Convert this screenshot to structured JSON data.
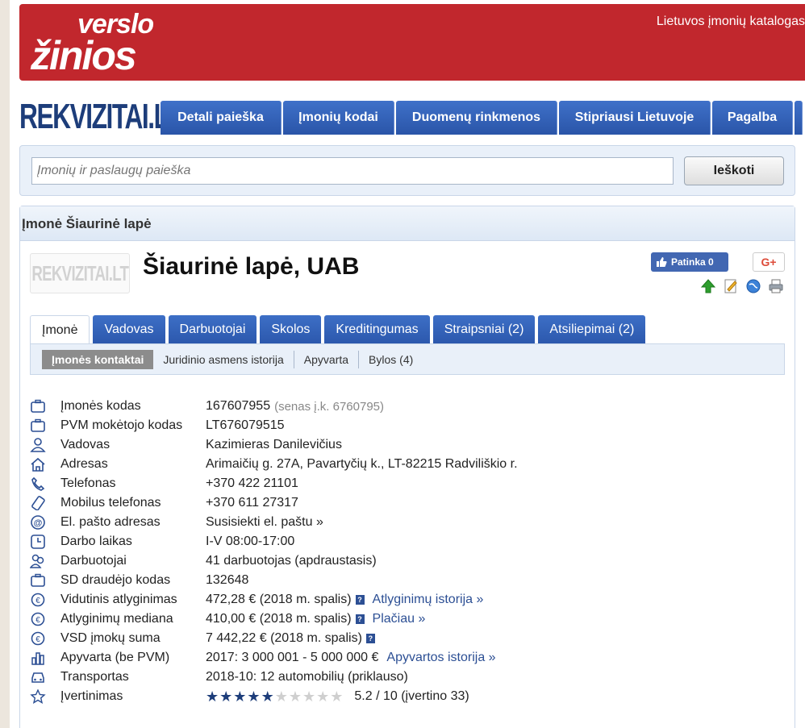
{
  "banner": {
    "logo_line1": "verslo",
    "logo_line2": "žinios",
    "right_text": "Lietuvos įmonių katalogas"
  },
  "rekvizitai_logo": {
    "main": "REKVIZITAI",
    "suffix": ".LT"
  },
  "nav": {
    "items": [
      {
        "label": "Detali paieška"
      },
      {
        "label": "Įmonių kodai"
      },
      {
        "label": "Duomenų rinkmenos"
      },
      {
        "label": "Stipriausi Lietuvoje"
      },
      {
        "label": "Pagalba"
      }
    ]
  },
  "search": {
    "placeholder": "Įmonių ir paslaugų paieška",
    "button_label": "Ieškoti"
  },
  "company": {
    "panel_title": "Įmonė Šiaurinė lapė",
    "thumb_text": "REKVIZITAI.LT",
    "name": "Šiaurinė lapė, UAB",
    "like_label": "Patinka 0",
    "gplus_label": "G+"
  },
  "tabs": [
    {
      "label": "Įmonė"
    },
    {
      "label": "Vadovas"
    },
    {
      "label": "Darbuotojai"
    },
    {
      "label": "Skolos"
    },
    {
      "label": "Kreditingumas"
    },
    {
      "label": "Straipsniai (2)"
    },
    {
      "label": "Atsiliepimai (2)"
    }
  ],
  "subtabs": [
    {
      "label": "Įmonės kontaktai"
    },
    {
      "label": "Juridinio asmens istorija"
    },
    {
      "label": "Apyvarta"
    },
    {
      "label": "Bylos (4)"
    }
  ],
  "info": {
    "code": {
      "label": "Įmonės kodas",
      "value": "167607955",
      "extra": "(senas į.k. 6760795)"
    },
    "vat": {
      "label": "PVM mokėtojo kodas",
      "value": "LT676079515"
    },
    "manager": {
      "label": "Vadovas",
      "value": "Kazimieras Danilevičius"
    },
    "address": {
      "label": "Adresas",
      "value": "Arimaičių g. 27A, Pavartyčių k., LT-82215 Radviliškio r."
    },
    "phone": {
      "label": "Telefonas",
      "value": "+370 422 21101"
    },
    "mobile": {
      "label": "Mobilus telefonas",
      "value": "+370 611 27317"
    },
    "email": {
      "label": "El. pašto adresas",
      "value": "Susisiekti el. paštu »"
    },
    "hours": {
      "label": "Darbo laikas",
      "value": "I-V 08:00-17:00"
    },
    "employees": {
      "label": "Darbuotojai",
      "value": "41 darbuotojas (apdraustasis)"
    },
    "sd_code": {
      "label": "SD draudėjo kodas",
      "value": "132648"
    },
    "avg_salary": {
      "label": "Vidutinis atlyginimas",
      "value": "472,28 € (2018 m. spalis)",
      "link": "Atlyginimų istorija »"
    },
    "median_salary": {
      "label": "Atlyginimų mediana",
      "value": "410,00 € (2018 m. spalis)",
      "link": "Plačiau »"
    },
    "vsd": {
      "label": "VSD įmokų suma",
      "value": "7 442,22 € (2018 m. spalis)"
    },
    "turnover": {
      "label": "Apyvarta (be PVM)",
      "value": "2017: 3 000 001 - 5 000 000 €",
      "link": "Apyvartos istorija »"
    },
    "transport": {
      "label": "Transportas",
      "value": "2018-10: 12 automobilių (priklauso)"
    },
    "rating": {
      "label": "Įvertinimas",
      "score": 5.2,
      "max": 10,
      "text": "5.2 / 10 (įvertino 33)"
    }
  },
  "colors": {
    "brand_red": "#c1272d",
    "nav_blue": "#2a55a8",
    "link_blue": "#2c4f94",
    "star_blue": "#1d3d7a"
  }
}
